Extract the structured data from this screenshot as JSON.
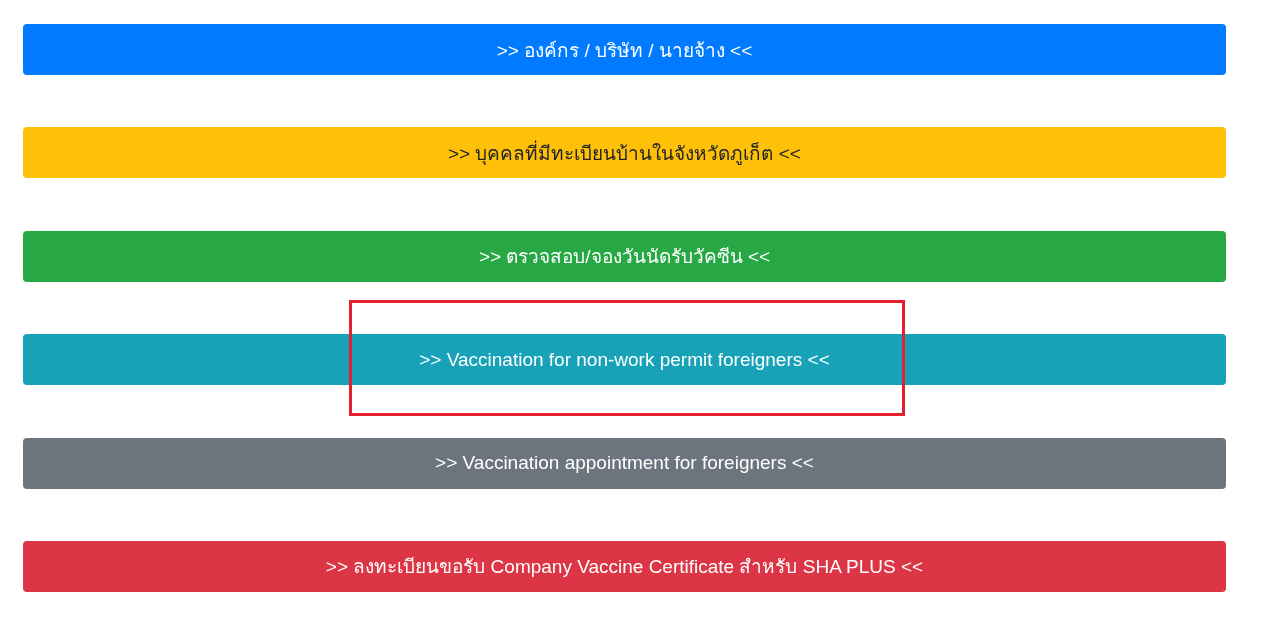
{
  "buttons": [
    {
      "label": ">> องค์กร / บริษัท / นายจ้าง <<",
      "kind": "primary",
      "highlighted": false
    },
    {
      "label": ">> บุคคลที่มีทะเบียนบ้านในจังหวัดภูเก็ต <<",
      "kind": "warning",
      "highlighted": false
    },
    {
      "label": ">> ตรวจสอบ/จองวันนัดรับวัคซีน <<",
      "kind": "success",
      "highlighted": false
    },
    {
      "label": ">> Vaccination for non-work permit foreigners <<",
      "kind": "info",
      "highlighted": true
    },
    {
      "label": ">> Vaccination appointment for foreigners <<",
      "kind": "secondary",
      "highlighted": false
    },
    {
      "label": ">> ลงทะเบียนขอรับ Company Vaccine Certificate สำหรับ SHA PLUS <<",
      "kind": "danger",
      "highlighted": false
    }
  ]
}
